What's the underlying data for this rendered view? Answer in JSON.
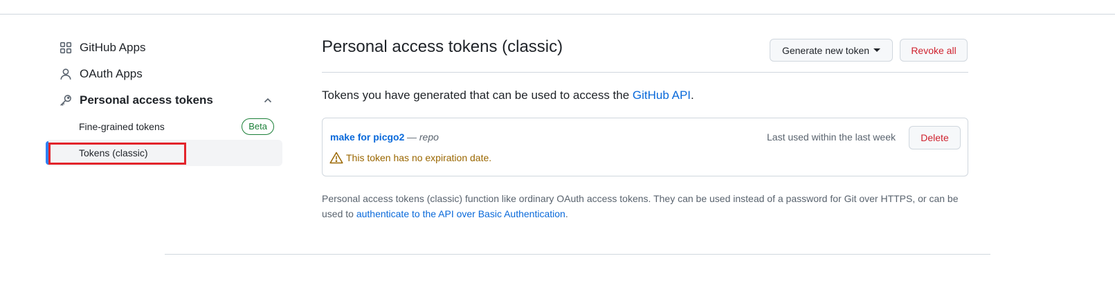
{
  "sidebar": {
    "items": [
      {
        "label": "GitHub Apps",
        "icon": "apps-icon"
      },
      {
        "label": "OAuth Apps",
        "icon": "person-icon"
      },
      {
        "label": "Personal access tokens",
        "icon": "key-icon",
        "expanded": true
      }
    ],
    "sub_items": [
      {
        "label": "Fine-grained tokens",
        "badge": "Beta"
      },
      {
        "label": "Tokens (classic)",
        "active": true
      }
    ]
  },
  "main": {
    "title": "Personal access tokens (classic)",
    "generate_button": "Generate new token",
    "revoke_button": "Revoke all",
    "intro_text": "Tokens you have generated that can be used to access the ",
    "intro_link": "GitHub API",
    "intro_end": ".",
    "token": {
      "name": "make for picgo2",
      "separator": " — ",
      "scope": "repo",
      "last_used": "Last used within the last week",
      "delete_button": "Delete",
      "warning": "This token has no expiration date."
    },
    "footnote_text": "Personal access tokens (classic) function like ordinary OAuth access tokens. They can be used instead of a password for Git over HTTPS, or can be used to ",
    "footnote_link": "authenticate to the API over Basic Authentication",
    "footnote_end": "."
  },
  "colors": {
    "accent": "#0969da",
    "danger": "#cf222e",
    "success": "#1a7f37",
    "warning": "#9a6700",
    "highlight": "#e3242b"
  }
}
